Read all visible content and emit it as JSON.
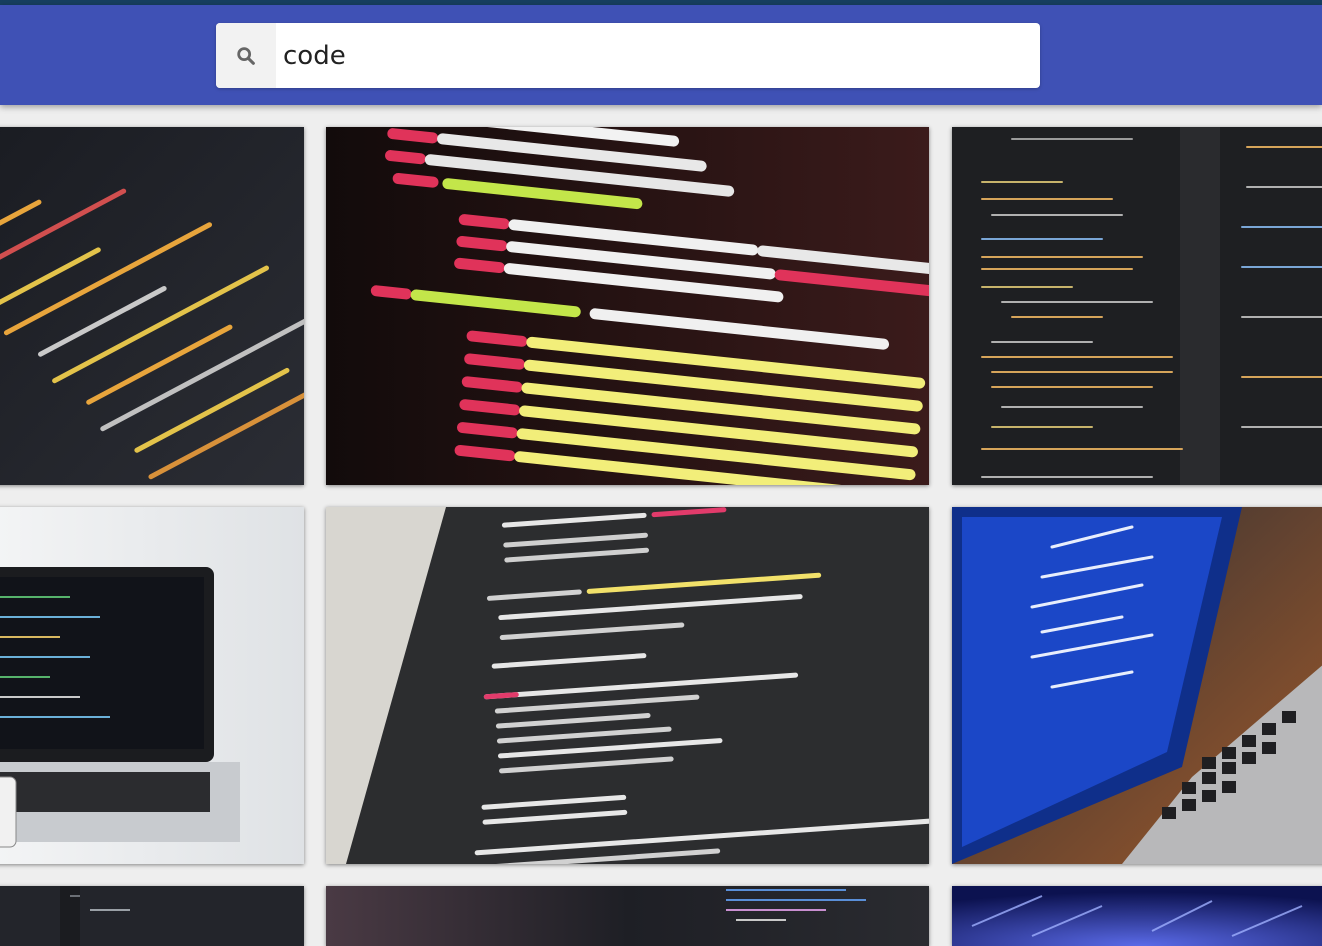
{
  "search": {
    "value": "code",
    "icon": "search-icon"
  },
  "colors": {
    "header": "#3f51b5",
    "topline": "#173f5f",
    "background": "#eeeeee"
  },
  "results": [
    {
      "name": "code-closeup-yellow-orange"
    },
    {
      "name": "html-code-red-green"
    },
    {
      "name": "php-code-dark-editor"
    },
    {
      "name": "laptop-white-desk"
    },
    {
      "name": "angular-code-screen-angled"
    },
    {
      "name": "laptop-blue-code-keyboard"
    },
    {
      "name": "dark-editor-partial"
    },
    {
      "name": "code-monitor-partial"
    },
    {
      "name": "blue-abstract-partial"
    }
  ]
}
